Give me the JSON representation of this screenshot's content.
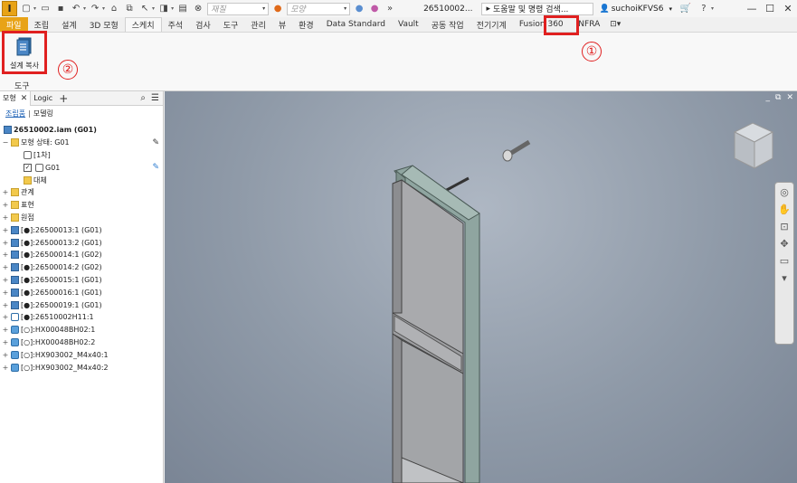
{
  "qat": {
    "logo": "I",
    "material_placeholder": "재질",
    "appearance_placeholder": "모양",
    "document_title": "26510002...",
    "help_search": "도움말 및 명령 검색...",
    "username": "suchoiKFVS6"
  },
  "tabs": [
    {
      "label": "파일"
    },
    {
      "label": "조립"
    },
    {
      "label": "설계"
    },
    {
      "label": "3D 모형"
    },
    {
      "label": "스케치"
    },
    {
      "label": "주석"
    },
    {
      "label": "검사"
    },
    {
      "label": "도구"
    },
    {
      "label": "관리"
    },
    {
      "label": "뷰"
    },
    {
      "label": "환경"
    },
    {
      "label": "Data Standard"
    },
    {
      "label": "Vault"
    },
    {
      "label": "공동 작업"
    },
    {
      "label": "전기기계"
    },
    {
      "label": "Fusion 360"
    },
    {
      "label": "INFRA"
    }
  ],
  "ribbon": {
    "design_copy_label": "설계 복사",
    "panel_label": "도구"
  },
  "annotations": {
    "one": "①",
    "two": "②"
  },
  "browser": {
    "tab_model": "모형",
    "tab_logic": "Logic",
    "sub_assembly": "조립품",
    "sub_modeling": "모델링",
    "tree": [
      {
        "label": "26510002.iam (G01)"
      },
      {
        "label": "모형 상태: G01"
      },
      {
        "label": "[1차]"
      },
      {
        "label": "G01"
      },
      {
        "label": "대체"
      },
      {
        "label": "관계"
      },
      {
        "label": "표현"
      },
      {
        "label": "원점"
      },
      {
        "label": "[●]:26500013:1 (G01)"
      },
      {
        "label": "[●]:26500013:2 (G01)"
      },
      {
        "label": "[●]:26500014:1 (G02)"
      },
      {
        "label": "[●]:26500014:2 (G02)"
      },
      {
        "label": "[●]:26500015:1 (G01)"
      },
      {
        "label": "[●]:26500016:1 (G01)"
      },
      {
        "label": "[●]:26500019:1 (G01)"
      },
      {
        "label": "[●]:26510002H11:1"
      },
      {
        "label": "[○]:HX00048BH02:1"
      },
      {
        "label": "[○]:HX00048BH02:2"
      },
      {
        "label": "[○]:HX903002_M4x40:1"
      },
      {
        "label": "[○]:HX903002_M4x40:2"
      }
    ]
  },
  "colors": {
    "accent": "#e8a317",
    "highlight": "#e02020",
    "link": "#1a5fb4"
  }
}
